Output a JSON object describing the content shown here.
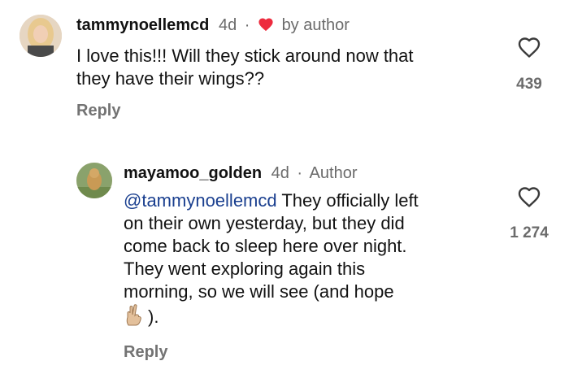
{
  "comment1": {
    "username": "tammynoellemcd",
    "time": "4d",
    "separator": "·",
    "liked_by_author_text": "by author",
    "text_line1": "I love this!!! Will they stick around now that",
    "text_line2": "they have their wings??",
    "likes": "439",
    "reply_label": "Reply"
  },
  "comment2": {
    "username": "mayamoo_golden",
    "time": "4d",
    "separator": "·",
    "author_badge": "Author",
    "mention": "@tammynoellemcd",
    "text_line1_rest": " They officially left",
    "text_line2": "on their own yesterday, but they did",
    "text_line3": "come back to sleep here over night.",
    "text_line4": "They went exploring again this",
    "text_line5": "morning, so we will see (and hope",
    "text_line6_rest": ").",
    "emoji": "crossed-fingers-emoji",
    "likes": "1 274",
    "reply_label": "Reply"
  },
  "colors": {
    "meta_gray": "#6b6b6b",
    "mention_blue": "#1a3f8f",
    "heart_red": "#ed2b3e"
  }
}
